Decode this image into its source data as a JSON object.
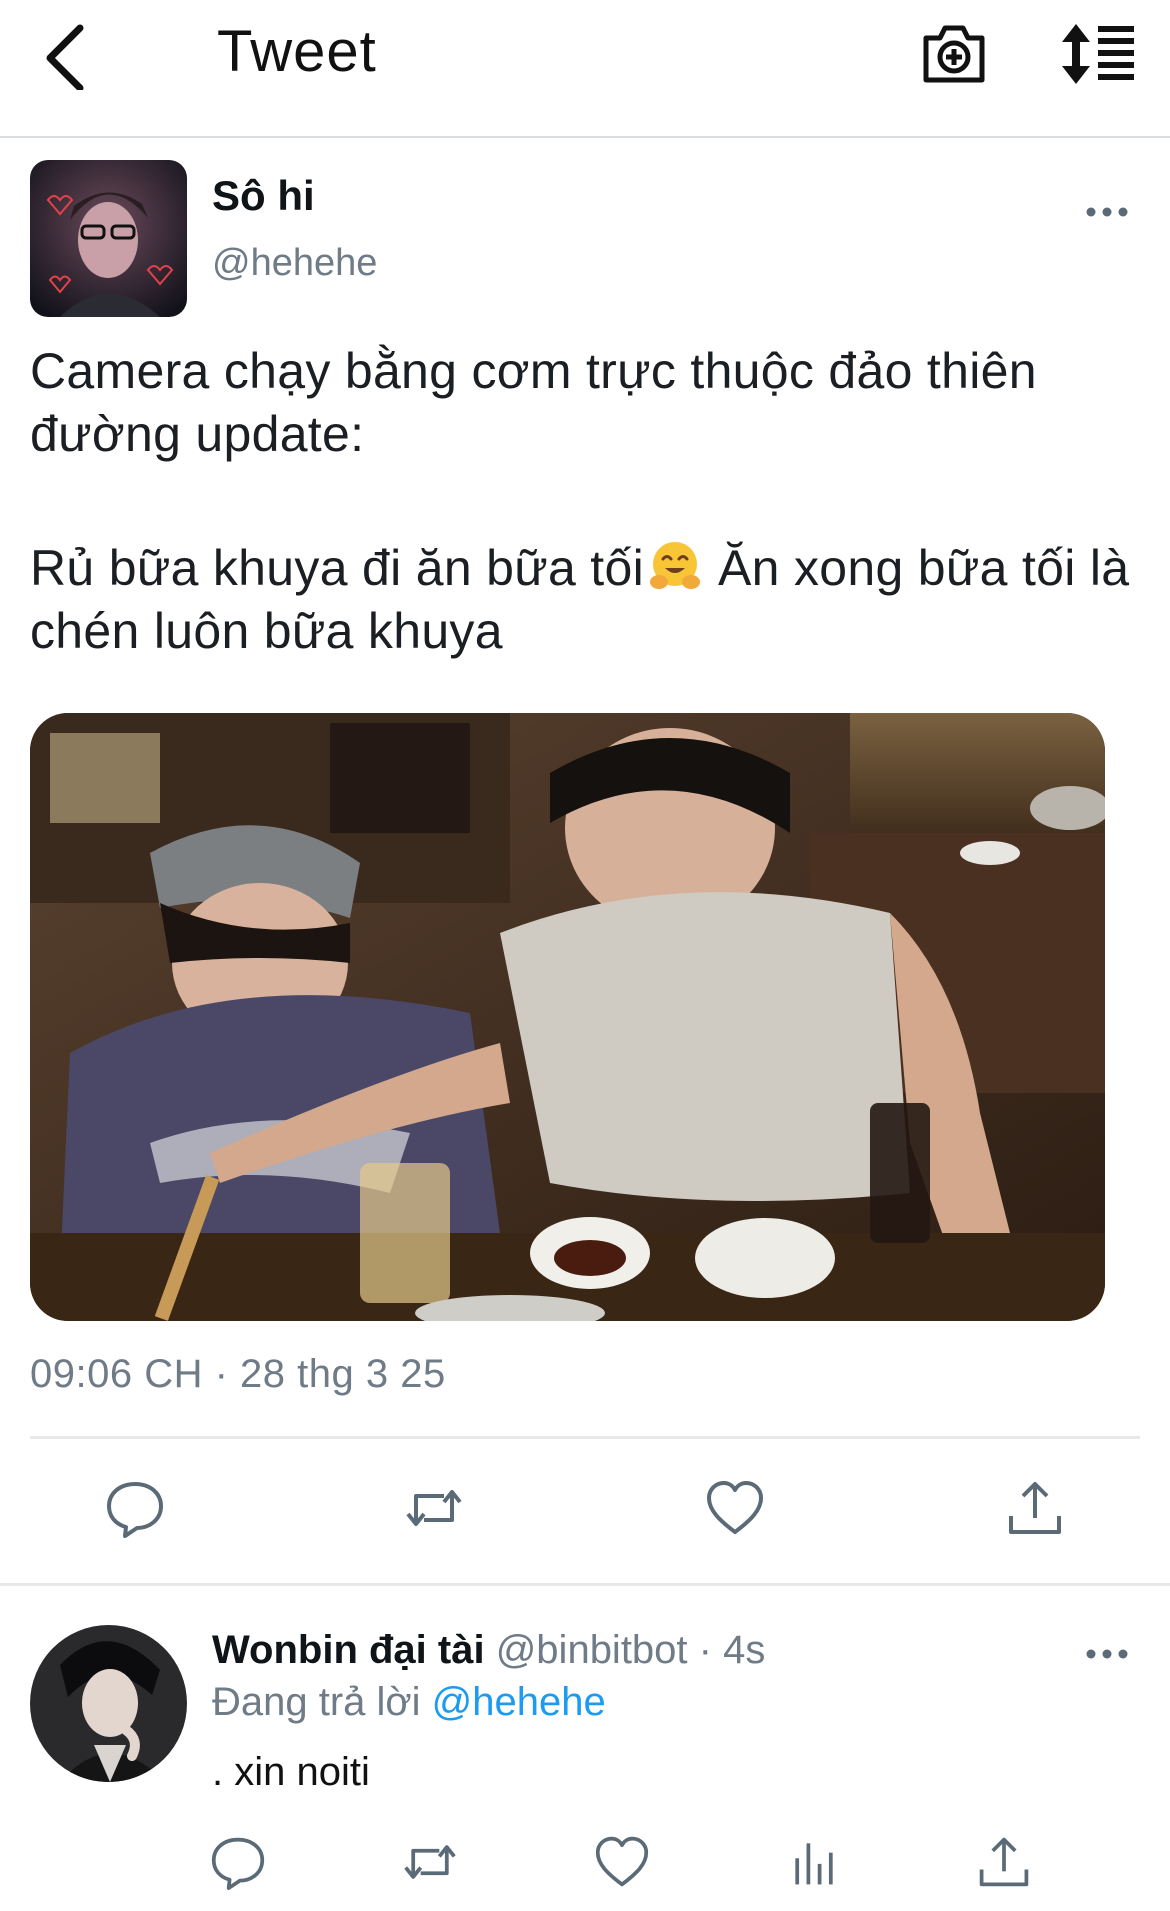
{
  "header": {
    "title": "Tweet",
    "icons": [
      "chevron-left-icon",
      "camera-plus-icon",
      "sort-list-icon"
    ]
  },
  "tweet": {
    "author_name": "Sô hi",
    "author_handle": "@hehehe",
    "text_line1": "Camera chạy bằng cơm trực thuộc đảo thiên đường update:",
    "text_line2a": "Rủ bữa khuya đi ăn bữa tối",
    "text_line2b": "Ăn xong bữa tối là chén luôn bữa khuya",
    "emoji": "hugging-face-emoji",
    "timestamp": "09:06 CH · 28 thg 3 25",
    "actions": [
      "reply-icon",
      "retweet-icon",
      "like-icon",
      "share-icon"
    ]
  },
  "reply": {
    "author_name": "Wonbin đại tài",
    "meta": "@binbitbot · 4s",
    "replying_prefix": "Đang trả lời",
    "replying_handle": "@hehehe",
    "text": ". xin noiti",
    "actions": [
      "reply-icon",
      "retweet-icon",
      "like-icon",
      "analytics-icon",
      "share-icon"
    ]
  },
  "colors": {
    "accent": "#1d9bf0",
    "secondary_text": "#6f7b86",
    "divider": "#e6e8ea",
    "icon": "#5b6a77"
  }
}
